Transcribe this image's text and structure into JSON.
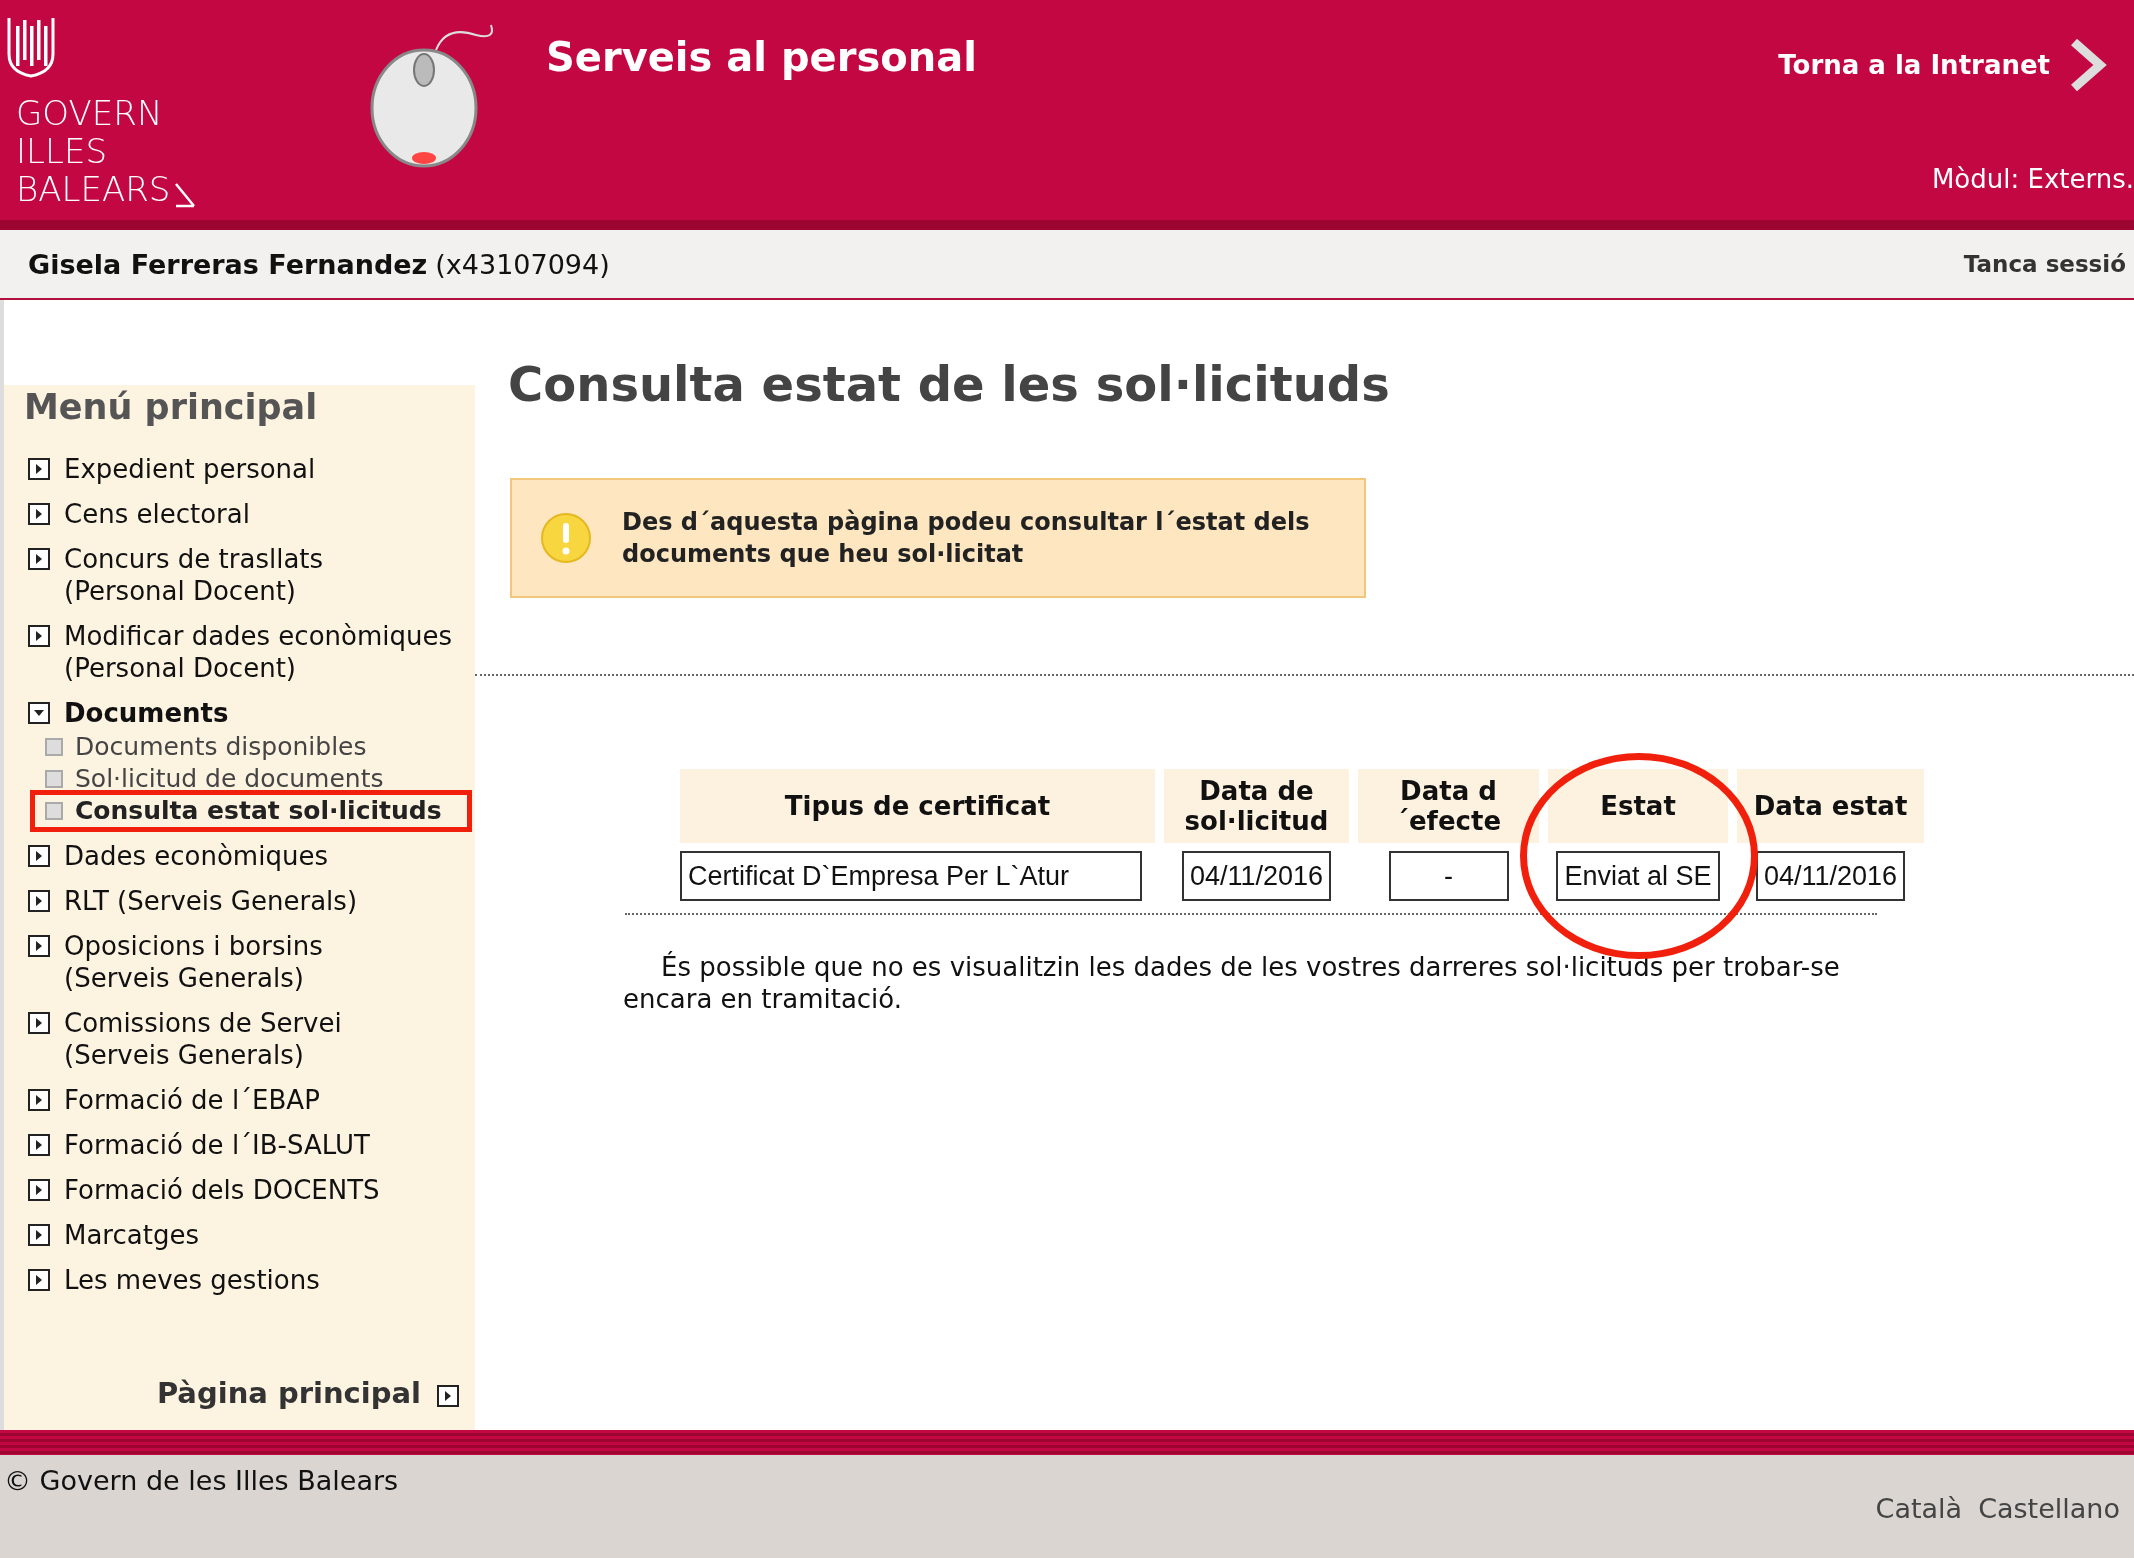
{
  "header": {
    "logo_lines": [
      "GOVERN",
      "ILLES",
      "BALEARS"
    ],
    "title": "Serveis al personal",
    "back_link": "Torna a la Intranet",
    "module": "Mòdul: Externs."
  },
  "user_bar": {
    "name": "Gisela Ferreras Fernandez",
    "id": "(x43107094)",
    "logout": "Tanca sessió"
  },
  "sidebar": {
    "title": "Menú principal",
    "items": [
      {
        "label": "Expedient personal",
        "expanded": false
      },
      {
        "label": "Cens electoral",
        "expanded": false
      },
      {
        "label": "Concurs de trasllats\n(Personal Docent)",
        "expanded": false
      },
      {
        "label": "Modificar dades econòmiques\n(Personal Docent)",
        "expanded": false
      },
      {
        "label": "Documents",
        "expanded": true,
        "children": [
          {
            "label": "Documents disponibles",
            "selected": false
          },
          {
            "label": "Sol·licitud de documents",
            "selected": false
          },
          {
            "label": "Consulta estat sol·licituds",
            "selected": true
          }
        ]
      },
      {
        "label": "Dades econòmiques",
        "expanded": false
      },
      {
        "label": "RLT (Serveis Generals)",
        "expanded": false
      },
      {
        "label": "Oposicions i borsins\n(Serveis Generals)",
        "expanded": false
      },
      {
        "label": "Comissions de Servei\n(Serveis Generals)",
        "expanded": false
      },
      {
        "label": "Formació de l´EBAP",
        "expanded": false
      },
      {
        "label": "Formació de l´IB-SALUT",
        "expanded": false
      },
      {
        "label": "Formació dels DOCENTS",
        "expanded": false
      },
      {
        "label": "Marcatges",
        "expanded": false
      },
      {
        "label": "Les meves gestions",
        "expanded": false
      }
    ],
    "home_link": "Pàgina principal"
  },
  "main": {
    "title": "Consulta estat de les sol·licituds",
    "notice": "Des d´aquesta pàgina podeu consultar l´estat dels\ndocuments que heu sol·licitat",
    "table": {
      "columns": [
        {
          "label": "Tipus de certificat",
          "highlighted": false
        },
        {
          "label": "Data de\nsol·licitud",
          "highlighted": false
        },
        {
          "label": "Data d\n´efecte",
          "highlighted": false
        },
        {
          "label": "Estat",
          "highlighted": true
        },
        {
          "label": "Data estat",
          "highlighted": false
        }
      ],
      "rows": [
        [
          "Certificat D`Empresa Per L`Atur",
          "04/11/2016",
          "-",
          "Enviat al SE",
          "04/11/2016"
        ]
      ]
    },
    "note": "És possible que no es visualitzin les dades de les vostres darreres sol·licituds per trobar-se encara en tramitació."
  },
  "footer": {
    "copyright": "© Govern de les Illes Balears",
    "languages": [
      "Català",
      "Castellano"
    ]
  }
}
